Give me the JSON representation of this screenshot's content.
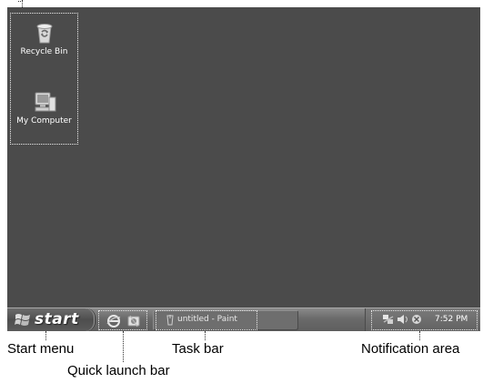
{
  "desktop": {
    "icons": [
      {
        "label": "Recycle Bin",
        "icon": "recycle-bin-icon"
      },
      {
        "label": "My Computer",
        "icon": "my-computer-icon"
      }
    ]
  },
  "taskbar": {
    "start_label": "start",
    "quick_launch": [
      {
        "icon": "internet-explorer-icon"
      },
      {
        "icon": "outlook-express-icon"
      }
    ],
    "task_button_label": "untitled - Paint",
    "tray": {
      "icons": [
        "network-icon",
        "volume-icon",
        "security-icon"
      ],
      "clock": "7:52 PM"
    }
  },
  "annotations": {
    "start_menu": "Start menu",
    "quick_launch_bar": "Quick launch bar",
    "task_bar": "Task bar",
    "notification_area": "Notification area"
  },
  "colors": {
    "desktop": "#4b4b4b",
    "taskbar": "#6e6e6e",
    "dotted_outline": "#e8e8e8",
    "text_light": "#ffffff"
  }
}
